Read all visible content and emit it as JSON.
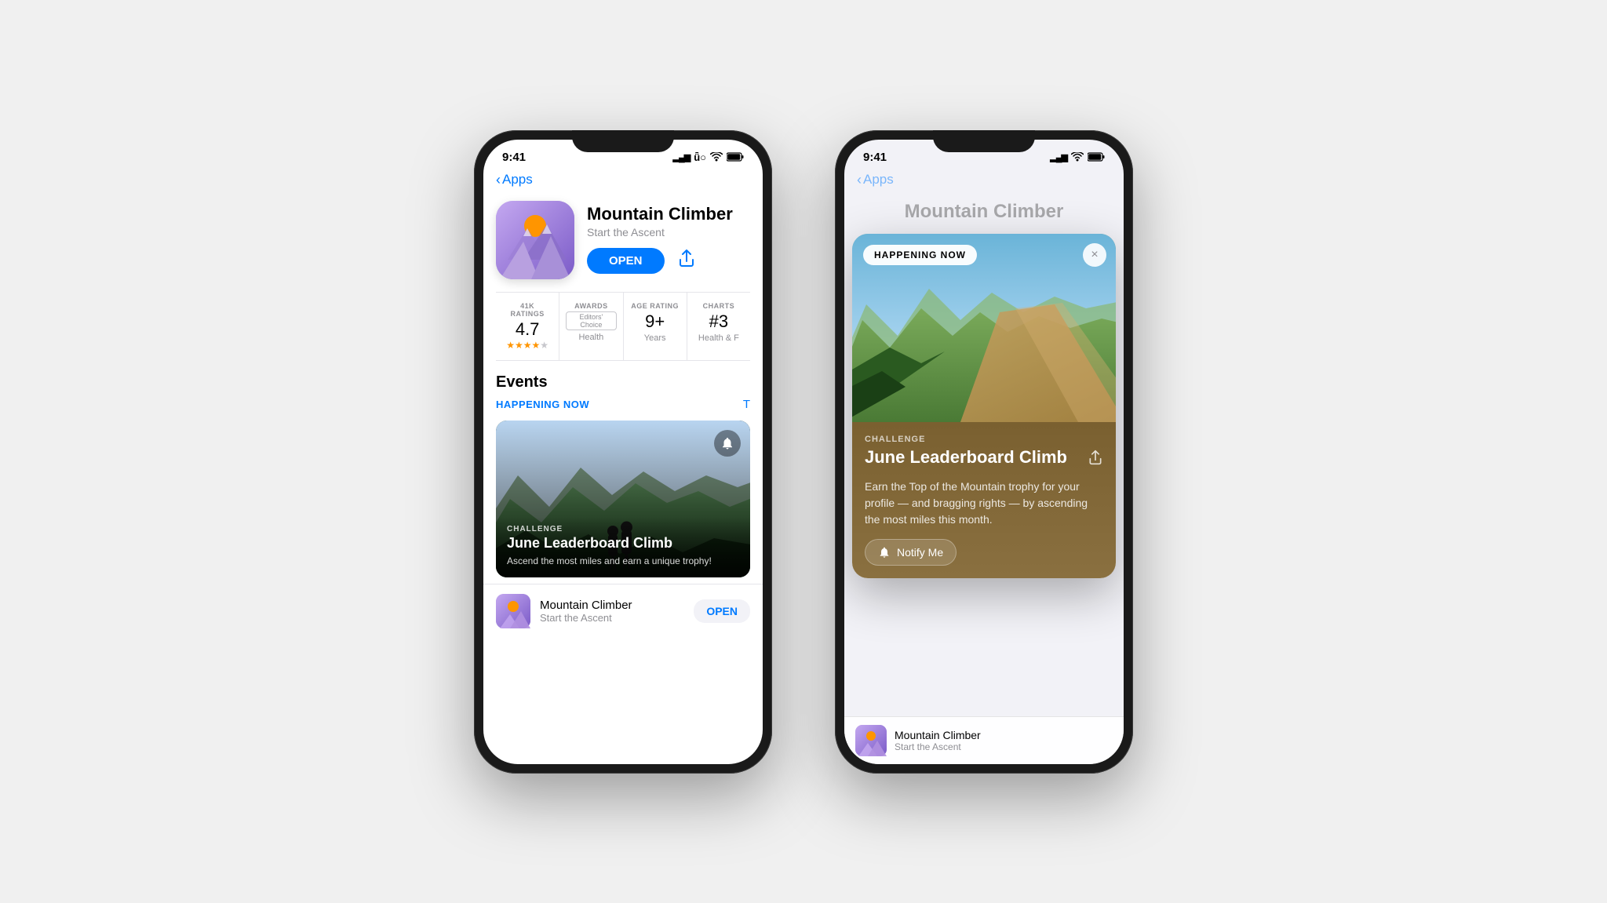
{
  "background_color": "#f0f0f0",
  "phone1": {
    "status_time": "9:41",
    "nav_back_label": "Apps",
    "app_name": "Mountain Climber",
    "app_subtitle": "Start the Ascent",
    "open_button_label": "OPEN",
    "ratings": {
      "count_label": "41K RATINGS",
      "count_value": "4.7",
      "stars": "★★★★",
      "awards_label": "AWARDS",
      "awards_badge": "Editors' Choice",
      "awards_sub": "Health",
      "age_label": "AGE RATING",
      "age_value": "9+",
      "age_sub": "Years",
      "chart_label": "CHARTS",
      "chart_value": "#3",
      "chart_sub": "Health & F"
    },
    "events_section": {
      "title": "Events",
      "filter_label": "HAPPENING NOW",
      "see_all_label": "T",
      "event": {
        "type": "CHALLENGE",
        "title": "June Leaderboard Climb",
        "description": "Ascend the most miles and earn a unique trophy!"
      }
    },
    "bottom_app": {
      "name": "Mountain Climber",
      "subtitle": "Start the Ascent",
      "open_label": "OPEN"
    }
  },
  "phone2": {
    "status_time": "9:41",
    "nav_back_label": "Apps",
    "app_name_bg": "Mountain Climber",
    "event_card": {
      "happening_badge": "HAPPENING NOW",
      "close_label": "×",
      "type": "CHALLENGE",
      "title": "June Leaderboard Climb",
      "share_icon": "⬆",
      "description": "Earn the Top of the Mountain trophy for your profile — and bragging rights — by ascending the most miles this month.",
      "notify_button": "Notify Me",
      "notify_icon": "🔔"
    },
    "bottom_app": {
      "name": "Mountain Climber",
      "subtitle": "Start the Ascent"
    }
  }
}
